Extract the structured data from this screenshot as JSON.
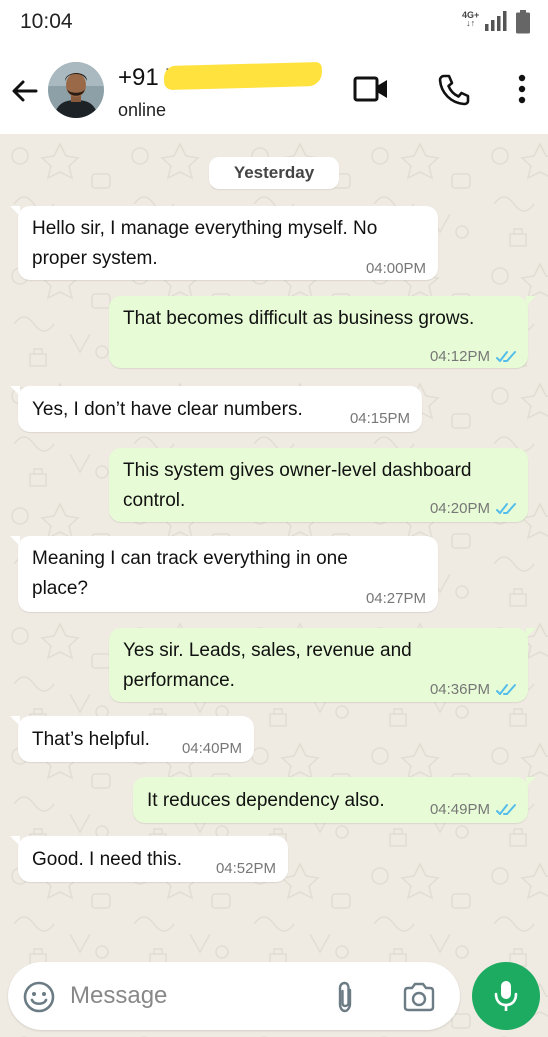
{
  "status_bar": {
    "time": "10:04",
    "network_label_top": "4G+",
    "network_label_bottom": "↓↑"
  },
  "header": {
    "contact_name": "+91 7          98",
    "contact_status": "online"
  },
  "chat": {
    "date_separator": "Yesterday",
    "messages": [
      {
        "direction": "incoming",
        "lines": [
          "Hello sir, I manage everything myself. No",
          "proper system."
        ],
        "time": "04:00PM"
      },
      {
        "direction": "outgoing",
        "lines": [
          "That becomes difficult as business grows."
        ],
        "time": "04:12PM",
        "read": true
      },
      {
        "direction": "incoming",
        "lines": [
          "Yes, I don’t have clear numbers."
        ],
        "time": "04:15PM"
      },
      {
        "direction": "outgoing",
        "lines": [
          "This system gives owner-level dashboard",
          "control."
        ],
        "time": "04:20PM",
        "read": true
      },
      {
        "direction": "incoming",
        "lines": [
          "Meaning I can track everything in one",
          "place?"
        ],
        "time": "04:27PM"
      },
      {
        "direction": "outgoing",
        "lines": [
          "Yes sir. Leads, sales, revenue and",
          "performance."
        ],
        "time": "04:36PM",
        "read": true
      },
      {
        "direction": "incoming",
        "lines": [
          "That’s helpful."
        ],
        "time": "04:40PM"
      },
      {
        "direction": "outgoing",
        "lines": [
          "It reduces dependency also."
        ],
        "time": "04:49PM",
        "read": true
      },
      {
        "direction": "incoming",
        "lines": [
          "Good. I need this."
        ],
        "time": "04:52PM"
      }
    ]
  },
  "composer": {
    "placeholder": "Message"
  },
  "icons": {
    "back": "arrow-left-icon",
    "video_call": "video-camera-icon",
    "voice_call": "phone-icon",
    "more": "more-vertical-icon",
    "emoji": "emoji-icon",
    "attach": "paperclip-icon",
    "camera": "camera-icon",
    "mic": "microphone-icon",
    "read_receipt": "double-check-icon"
  },
  "colors": {
    "chat_background": "#efeae2",
    "incoming_bubble": "#ffffff",
    "outgoing_bubble": "#e7fcd6",
    "read_receipt": "#53bdeb",
    "mic_button": "#1daa61",
    "name_redaction": "#ffe23d"
  }
}
